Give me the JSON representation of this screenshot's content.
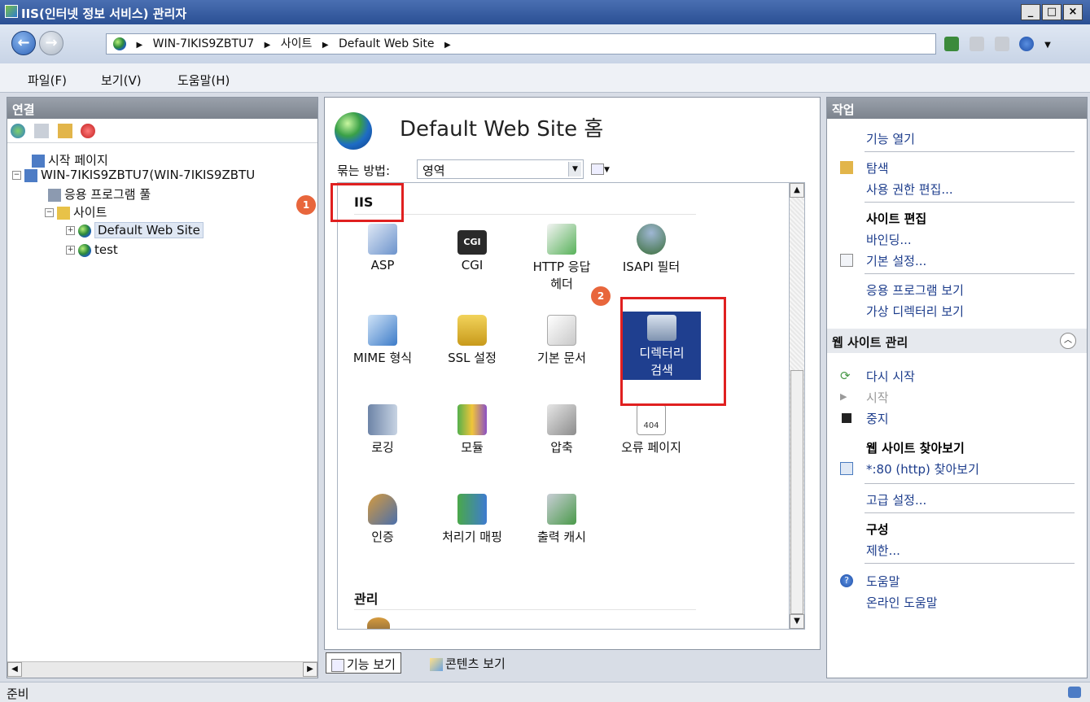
{
  "window": {
    "title": "IIS(인터넷 정보 서비스) 관리자"
  },
  "address": {
    "crumbs": [
      "WIN-7IKIS9ZBTU7",
      "사이트",
      "Default Web Site"
    ]
  },
  "menu": {
    "items": [
      "파일(F)",
      "보기(V)",
      "도움말(H)"
    ]
  },
  "connections": {
    "title": "연결",
    "tree": {
      "start": "시작 페이지",
      "server": "WIN-7IKIS9ZBTU7(WIN-7IKIS9ZBTU",
      "apppools": "응용 프로그램 풀",
      "sites": "사이트",
      "default_site": "Default Web Site",
      "test": "test"
    }
  },
  "center": {
    "title": "Default Web Site 홈",
    "group_label": "묶는 방법:",
    "group_value": "영역",
    "section_iis": "IIS",
    "section_manage": "관리",
    "features": {
      "asp": "ASP",
      "cgi": "CGI",
      "http1": "HTTP 응답",
      "http2": "헤더",
      "isapi": "ISAPI 필터",
      "mime": "MIME 형식",
      "ssl": "SSL 설정",
      "defdoc": "기본 문서",
      "dirbrowse1": "디렉터리",
      "dirbrowse2": "검색",
      "logging": "로깅",
      "modules": "모듈",
      "compression": "압축",
      "errorpages": "오류 페이지",
      "auth": "인증",
      "handlers": "처리기 매핑",
      "outputcache": "출력 캐시"
    },
    "cgi_badge": "CGI",
    "err_badge": "404",
    "tabs": {
      "features": "기능 보기",
      "content": "콘텐츠 보기"
    },
    "callouts": {
      "one": "1",
      "two": "2"
    }
  },
  "actions": {
    "title": "작업",
    "open_feature": "기능 열기",
    "explore": "탐색",
    "edit_perms": "사용 권한 편집...",
    "edit_site": "사이트 편집",
    "bindings": "바인딩...",
    "basic": "기본 설정...",
    "view_apps": "응용 프로그램 보기",
    "view_vdirs": "가상 디렉터리 보기",
    "manage_site": "웹 사이트 관리",
    "restart": "다시 시작",
    "start": "시작",
    "stop": "중지",
    "browse_site": "웹 사이트 찾아보기",
    "browse_80": "*:80 (http) 찾아보기",
    "advanced": "고급 설정...",
    "config": "구성",
    "limits": "제한...",
    "help": "도움말",
    "online_help": "온라인 도움말"
  },
  "status": {
    "text": "준비"
  }
}
